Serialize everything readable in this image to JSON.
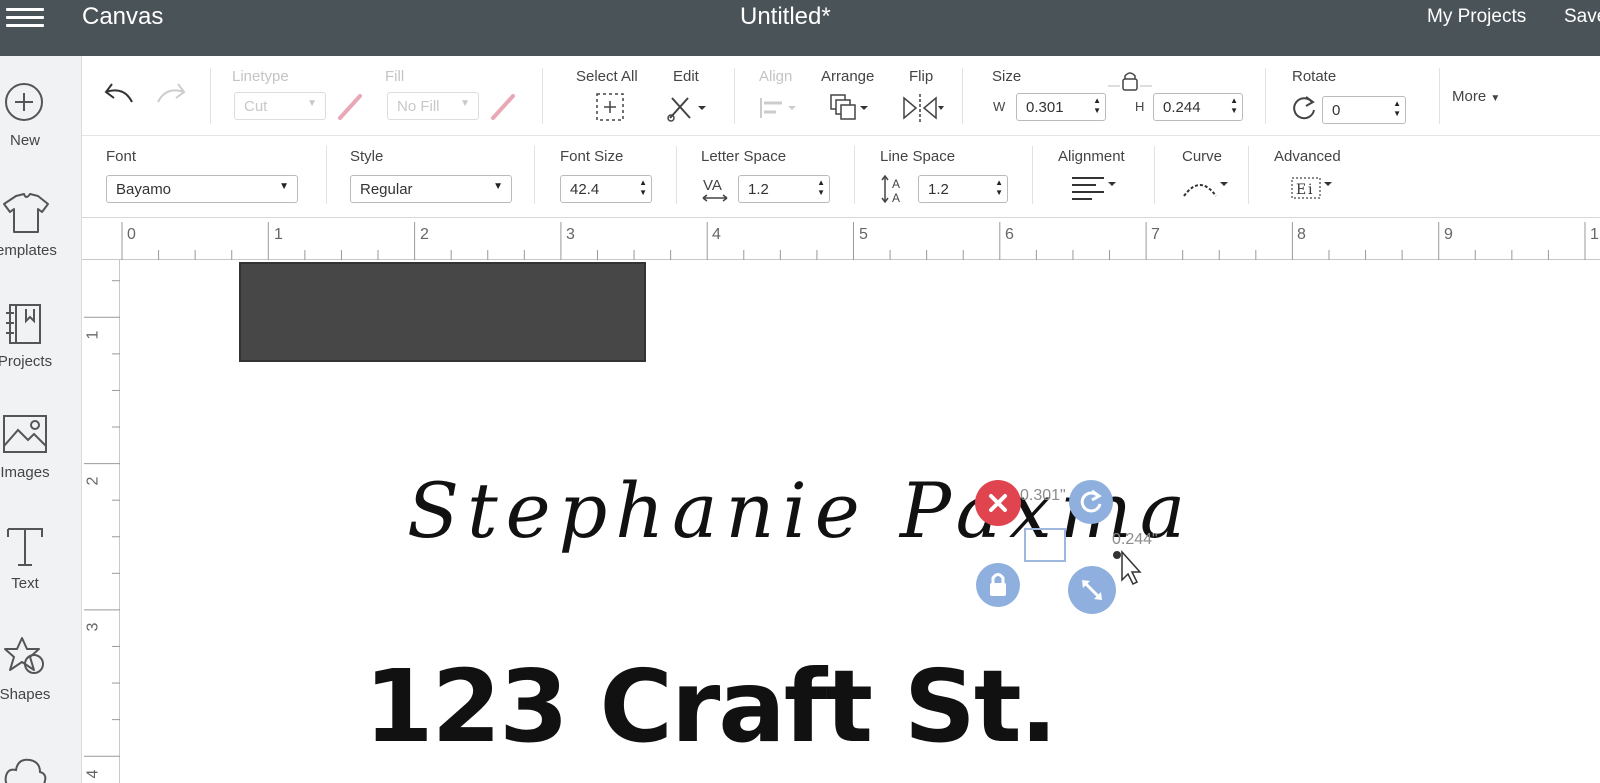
{
  "header": {
    "app_title": "Canvas",
    "doc_title": "Untitled*",
    "my_projects": "My Projects",
    "save": "Save"
  },
  "sidebar": {
    "items": [
      {
        "label": "New",
        "icon": "plus-circle-icon"
      },
      {
        "label": "emplates",
        "icon": "tshirt-icon"
      },
      {
        "label": "Projects",
        "icon": "projects-book-icon"
      },
      {
        "label": "Images",
        "icon": "image-icon"
      },
      {
        "label": "Text",
        "icon": "text-t-icon"
      },
      {
        "label": "Shapes",
        "icon": "shapes-icon"
      }
    ]
  },
  "toolbar_edit": {
    "linetype_label": "Linetype",
    "linetype_value": "Cut",
    "fill_label": "Fill",
    "fill_value": "No Fill",
    "select_all_label": "Select All",
    "edit_label": "Edit",
    "align_label": "Align",
    "arrange_label": "Arrange",
    "flip_label": "Flip",
    "size_label": "Size",
    "w_label": "W",
    "w_value": "0.301",
    "h_label": "H",
    "h_value": "0.244",
    "rotate_label": "Rotate",
    "rotate_value": "0",
    "more_label": "More"
  },
  "toolbar_text": {
    "font_label": "Font",
    "font_value": "Bayamo",
    "style_label": "Style",
    "style_value": "Regular",
    "font_size_label": "Font Size",
    "font_size_value": "42.4",
    "letter_space_label": "Letter Space",
    "letter_space_value": "1.2",
    "line_space_label": "Line Space",
    "line_space_value": "1.2",
    "alignment_label": "Alignment",
    "curve_label": "Curve",
    "advanced_label": "Advanced"
  },
  "ruler": {
    "top": [
      "0",
      "1",
      "2",
      "3",
      "4",
      "5",
      "6",
      "7",
      "8",
      "9",
      "1"
    ],
    "left": [
      "1",
      "2",
      "3",
      "4"
    ]
  },
  "canvas": {
    "script_text": "Stephanie Paxma",
    "address_text": "123 Craft St.",
    "width_readout": "0.301\"",
    "height_readout": "0.244\"",
    "colors": {
      "delete_handle": "#e0454f",
      "blue_handle": "#8fb0de",
      "header_bg": "#4a5358",
      "shape_fill": "#474747"
    }
  }
}
